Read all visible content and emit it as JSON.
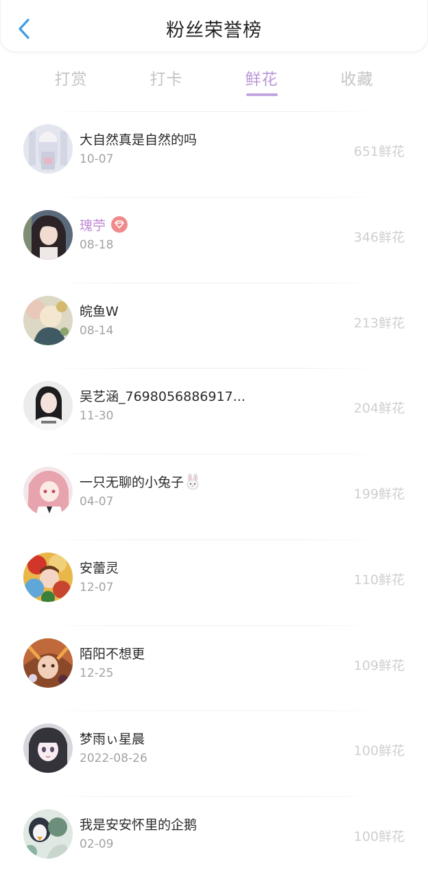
{
  "header": {
    "title": "粉丝荣誉榜"
  },
  "tabs": [
    {
      "label": "打赏"
    },
    {
      "label": "打卡"
    },
    {
      "label": "鲜花"
    },
    {
      "label": "收藏"
    }
  ],
  "active_tab": "鲜花",
  "fans": [
    {
      "name": "大自然真是自然的吗",
      "date": "10-07",
      "amount": "651鲜花"
    },
    {
      "name": "瑰苧",
      "date": "08-18",
      "amount": "346鲜花"
    },
    {
      "name": "皖鱼W",
      "date": "08-14",
      "amount": "213鲜花"
    },
    {
      "name": "吴艺涵_7698056886917...",
      "date": "11-30",
      "amount": "204鲜花"
    },
    {
      "name": "一只无聊的小兔子",
      "date": "04-07",
      "amount": "199鲜花"
    },
    {
      "name": "安蕾灵",
      "date": "12-07",
      "amount": "110鲜花"
    },
    {
      "name": "陌阳不想更",
      "date": "12-25",
      "amount": "109鲜花"
    },
    {
      "name": "梦雨ぃ星晨",
      "date": "2022-08-26",
      "amount": "100鲜花"
    },
    {
      "name": "我是安安怀里的企鹅",
      "date": "02-09",
      "amount": "100鲜花"
    }
  ],
  "icons": {
    "back": "chevron-left-icon",
    "vip": "diamond-badge-icon",
    "emoji": "rabbit-emoji-icon"
  },
  "colors": {
    "accent": "#b996d6",
    "back_arrow": "#3a9be8",
    "inactive_tab": "#c4c4c4",
    "amount": "#cfcfcf",
    "vip_badge": "#f08a8a"
  }
}
